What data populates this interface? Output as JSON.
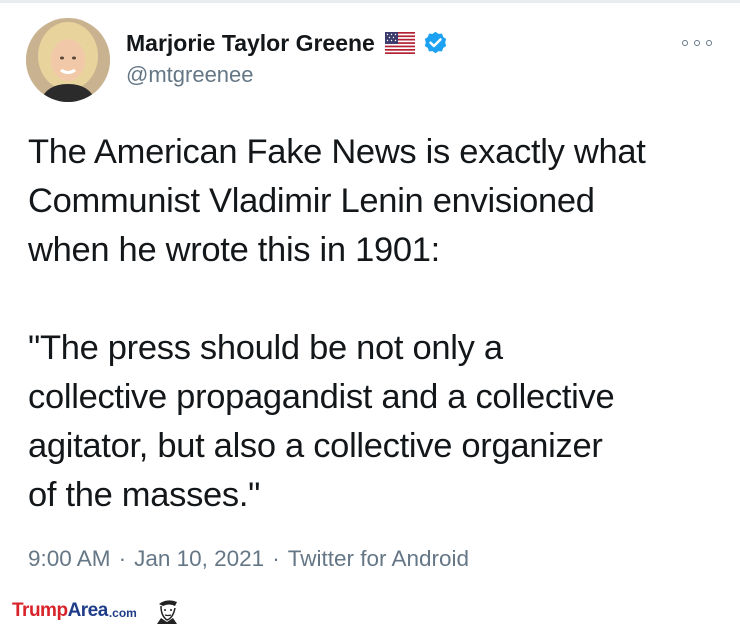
{
  "tweet": {
    "author": {
      "display_name": "Marjorie Taylor Greene",
      "handle": "@mtgreenee",
      "badges": [
        "us-flag-icon",
        "verified-icon"
      ]
    },
    "text_lines": [
      "The American Fake News is exactly what",
      "Communist Vladimir Lenin envisioned",
      "when he wrote this in 1901:",
      "",
      "\"The press should be not only a",
      "collective propagandist and a collective",
      "agitator, but also a collective organizer",
      "of the masses.\""
    ],
    "time": "9:00 AM",
    "date": "Jan 10, 2021",
    "source": "Twitter for Android",
    "separator": "·",
    "more_icon": "more-options-icon"
  },
  "watermark": {
    "part1": "Trump",
    "part2": "Area",
    "part3": ".com"
  },
  "colors": {
    "text_primary": "#14171a",
    "text_secondary": "#657786",
    "verified_blue": "#1da1f2",
    "watermark_red": "#d8232a",
    "watermark_blue": "#1f3c88"
  }
}
